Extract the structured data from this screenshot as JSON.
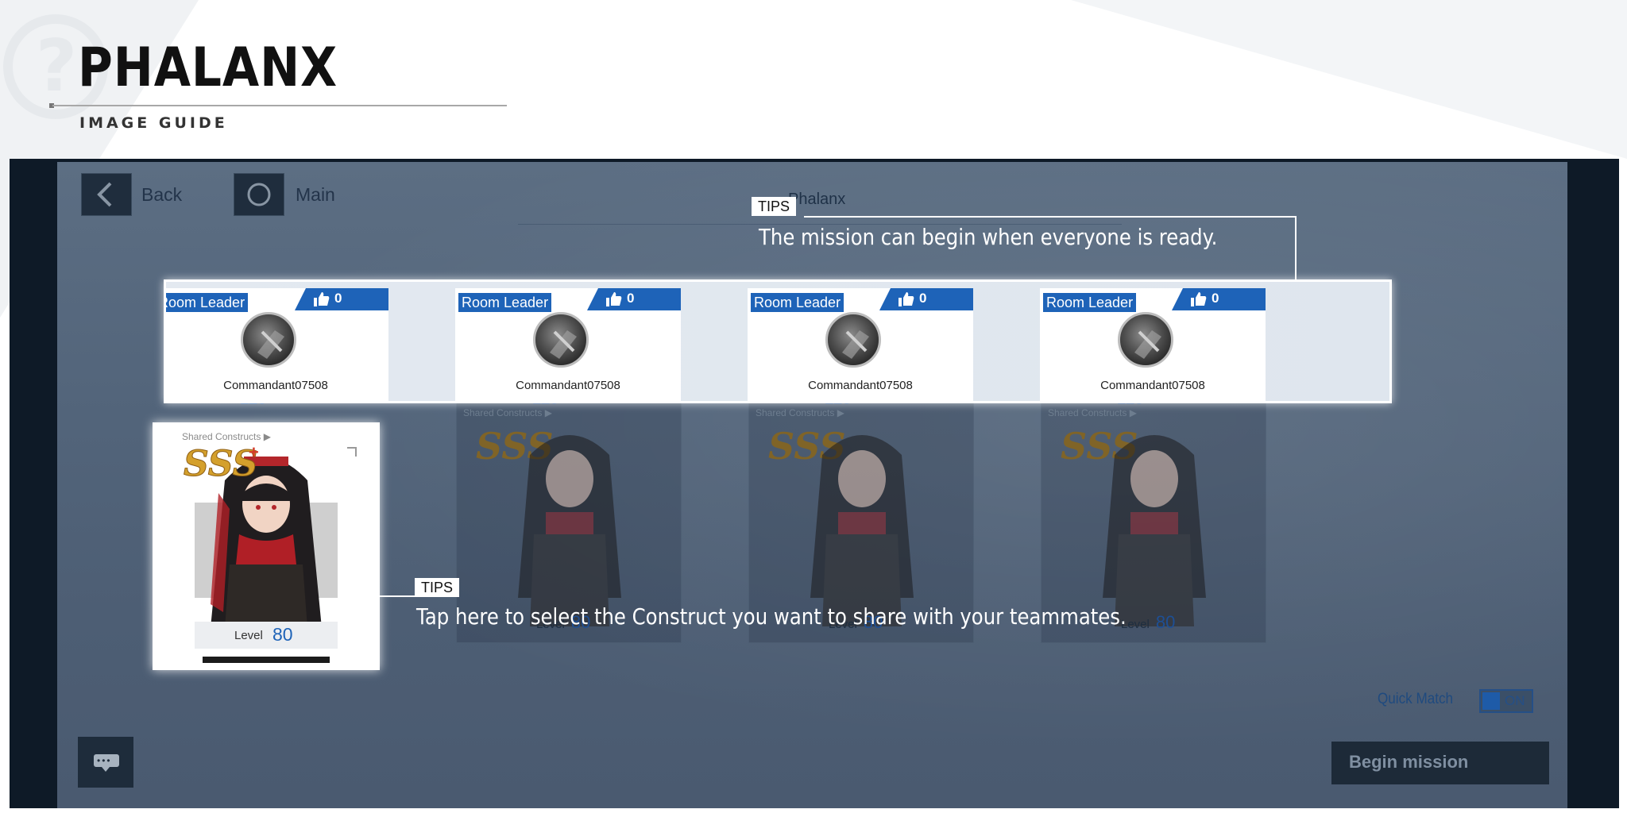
{
  "header": {
    "title": "PHALANX",
    "subtitle": "IMAGE GUIDE"
  },
  "game": {
    "nav": {
      "back_label": "Back",
      "main_label": "Main"
    },
    "room_title": "Phalanx",
    "players": [
      {
        "role": "Room Leader",
        "likes": "0",
        "name": "Commandant07508"
      },
      {
        "role": "Room Leader",
        "likes": "0",
        "name": "Commandant07508"
      },
      {
        "role": "Room Leader",
        "likes": "0",
        "name": "Commandant07508"
      },
      {
        "role": "Room Leader",
        "likes": "0",
        "name": "Commandant07508"
      }
    ],
    "construct": {
      "shared_label": "Shared Constructs ▶",
      "rank": "SSS",
      "rank_plus": "+",
      "level_label": "Level",
      "level_value": "80"
    },
    "dim_level_top": "120",
    "quick_match": {
      "label": "Quick Match",
      "state": "ON"
    },
    "begin_button": "Begin mission"
  },
  "tips": {
    "tag": "TIPS",
    "top_text": "The mission can begin when everyone is ready.",
    "bottom_text": "Tap here to select the Construct you want to share with your teammates."
  },
  "colors": {
    "accent_blue": "#1e63b8",
    "screen_bg": "#0e1a27",
    "overlay": "#52647a"
  },
  "icons": {
    "back": "chevron-left-icon",
    "main": "circle-icon",
    "like": "thumbs-up-icon",
    "chat": "chat-icon"
  }
}
